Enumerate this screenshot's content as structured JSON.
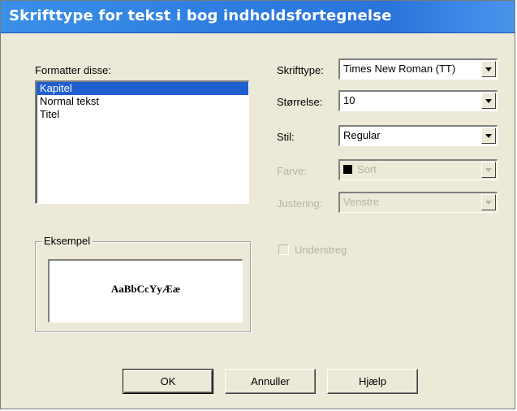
{
  "window": {
    "title": "Skrifttype for tekst i bog indholdsfortegnelse"
  },
  "format_list": {
    "label": "Formatter disse:",
    "items": [
      "Kapitel",
      "Normal tekst",
      "Titel"
    ],
    "selected_index": 0
  },
  "font": {
    "label": "Skrifttype:",
    "value": "Times New Roman (TT)"
  },
  "size": {
    "label": "Størrelse:",
    "value": "10"
  },
  "style": {
    "label": "Stil:",
    "value": "Regular"
  },
  "color": {
    "label": "Farve:",
    "value": "Sort",
    "swatch_color": "#000000",
    "enabled": false
  },
  "alignment": {
    "label": "Justering:",
    "value": "Venstre",
    "enabled": false
  },
  "underline": {
    "label": "Understreg",
    "checked": false,
    "enabled": false
  },
  "example": {
    "label": "Eksempel",
    "sample_text": "AaBbCcYyÆæ"
  },
  "buttons": {
    "ok": "OK",
    "cancel": "Annuller",
    "help": "Hjælp"
  },
  "colors": {
    "title_bar": "#2f7fe0",
    "selection": "#1f5fce",
    "dialog_bg": "#ece9d8",
    "disabled_text": "#b8b4a5"
  }
}
